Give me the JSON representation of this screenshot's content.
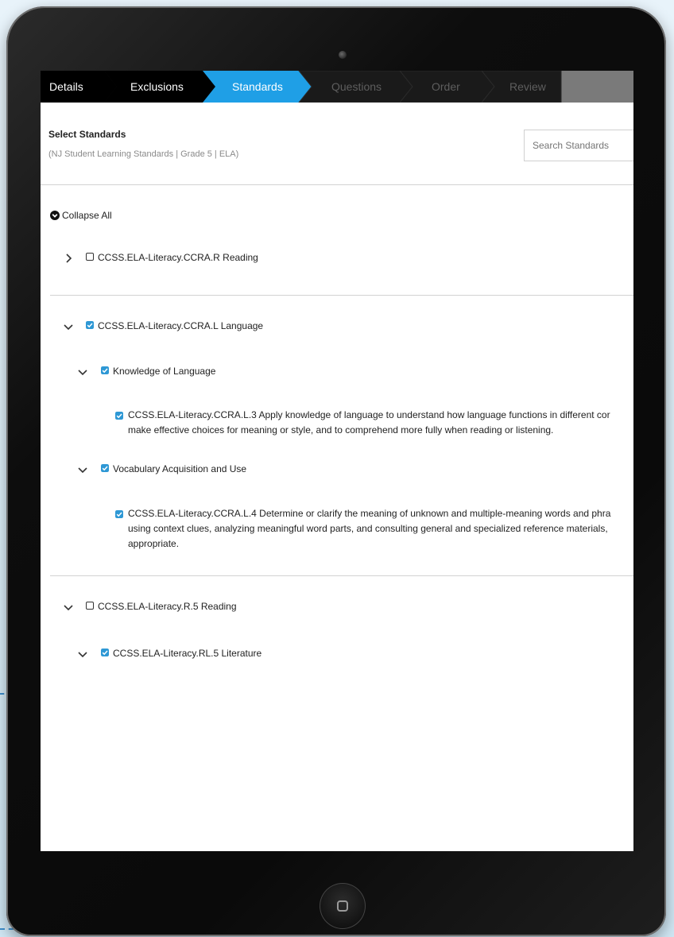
{
  "wizard": {
    "steps": [
      {
        "label": "Details",
        "state": "done"
      },
      {
        "label": "Exclusions",
        "state": "done"
      },
      {
        "label": "Standards",
        "state": "active"
      },
      {
        "label": "Questions",
        "state": "upcoming"
      },
      {
        "label": "Order",
        "state": "upcoming"
      },
      {
        "label": "Review",
        "state": "upcoming"
      }
    ]
  },
  "header": {
    "title": "Select Standards",
    "subtitle": "(NJ Student Learning Standards | Grade 5 | ELA)",
    "search_placeholder": "Search Standards"
  },
  "tree": {
    "collapse_all_label": "Collapse All",
    "groups": [
      {
        "label": "CCSS.ELA-Literacy.CCRA.R Reading",
        "expanded": false,
        "checked": false
      },
      {
        "label": "CCSS.ELA-Literacy.CCRA.L Language",
        "expanded": true,
        "checked": true,
        "children": [
          {
            "label": "Knowledge of Language",
            "expanded": true,
            "checked": true,
            "standards": [
              {
                "lines": [
                  "CCSS.ELA-Literacy.CCRA.L.3 Apply knowledge of language to understand how language functions in different cor",
                  "make effective choices for meaning or style, and to comprehend more fully when reading or listening."
                ],
                "checked": true
              }
            ]
          },
          {
            "label": "Vocabulary Acquisition and Use",
            "expanded": true,
            "checked": true,
            "standards": [
              {
                "lines": [
                  "CCSS.ELA-Literacy.CCRA.L.4 Determine or clarify the meaning of unknown and multiple-meaning words and phra",
                  "using context clues, analyzing meaningful word parts, and consulting general and specialized reference materials,",
                  "appropriate."
                ],
                "checked": true
              }
            ]
          }
        ]
      },
      {
        "label": "CCSS.ELA-Literacy.R.5 Reading",
        "expanded": true,
        "checked": false,
        "children": [
          {
            "label": "CCSS.ELA-Literacy.RL.5 Literature",
            "expanded": true,
            "checked": true
          }
        ]
      }
    ]
  },
  "colors": {
    "accent": "#2e98d5",
    "wizard_done": "#000000",
    "wizard_upcoming": "#1a1a1a",
    "wizard_tail": "#7a7a7a"
  }
}
